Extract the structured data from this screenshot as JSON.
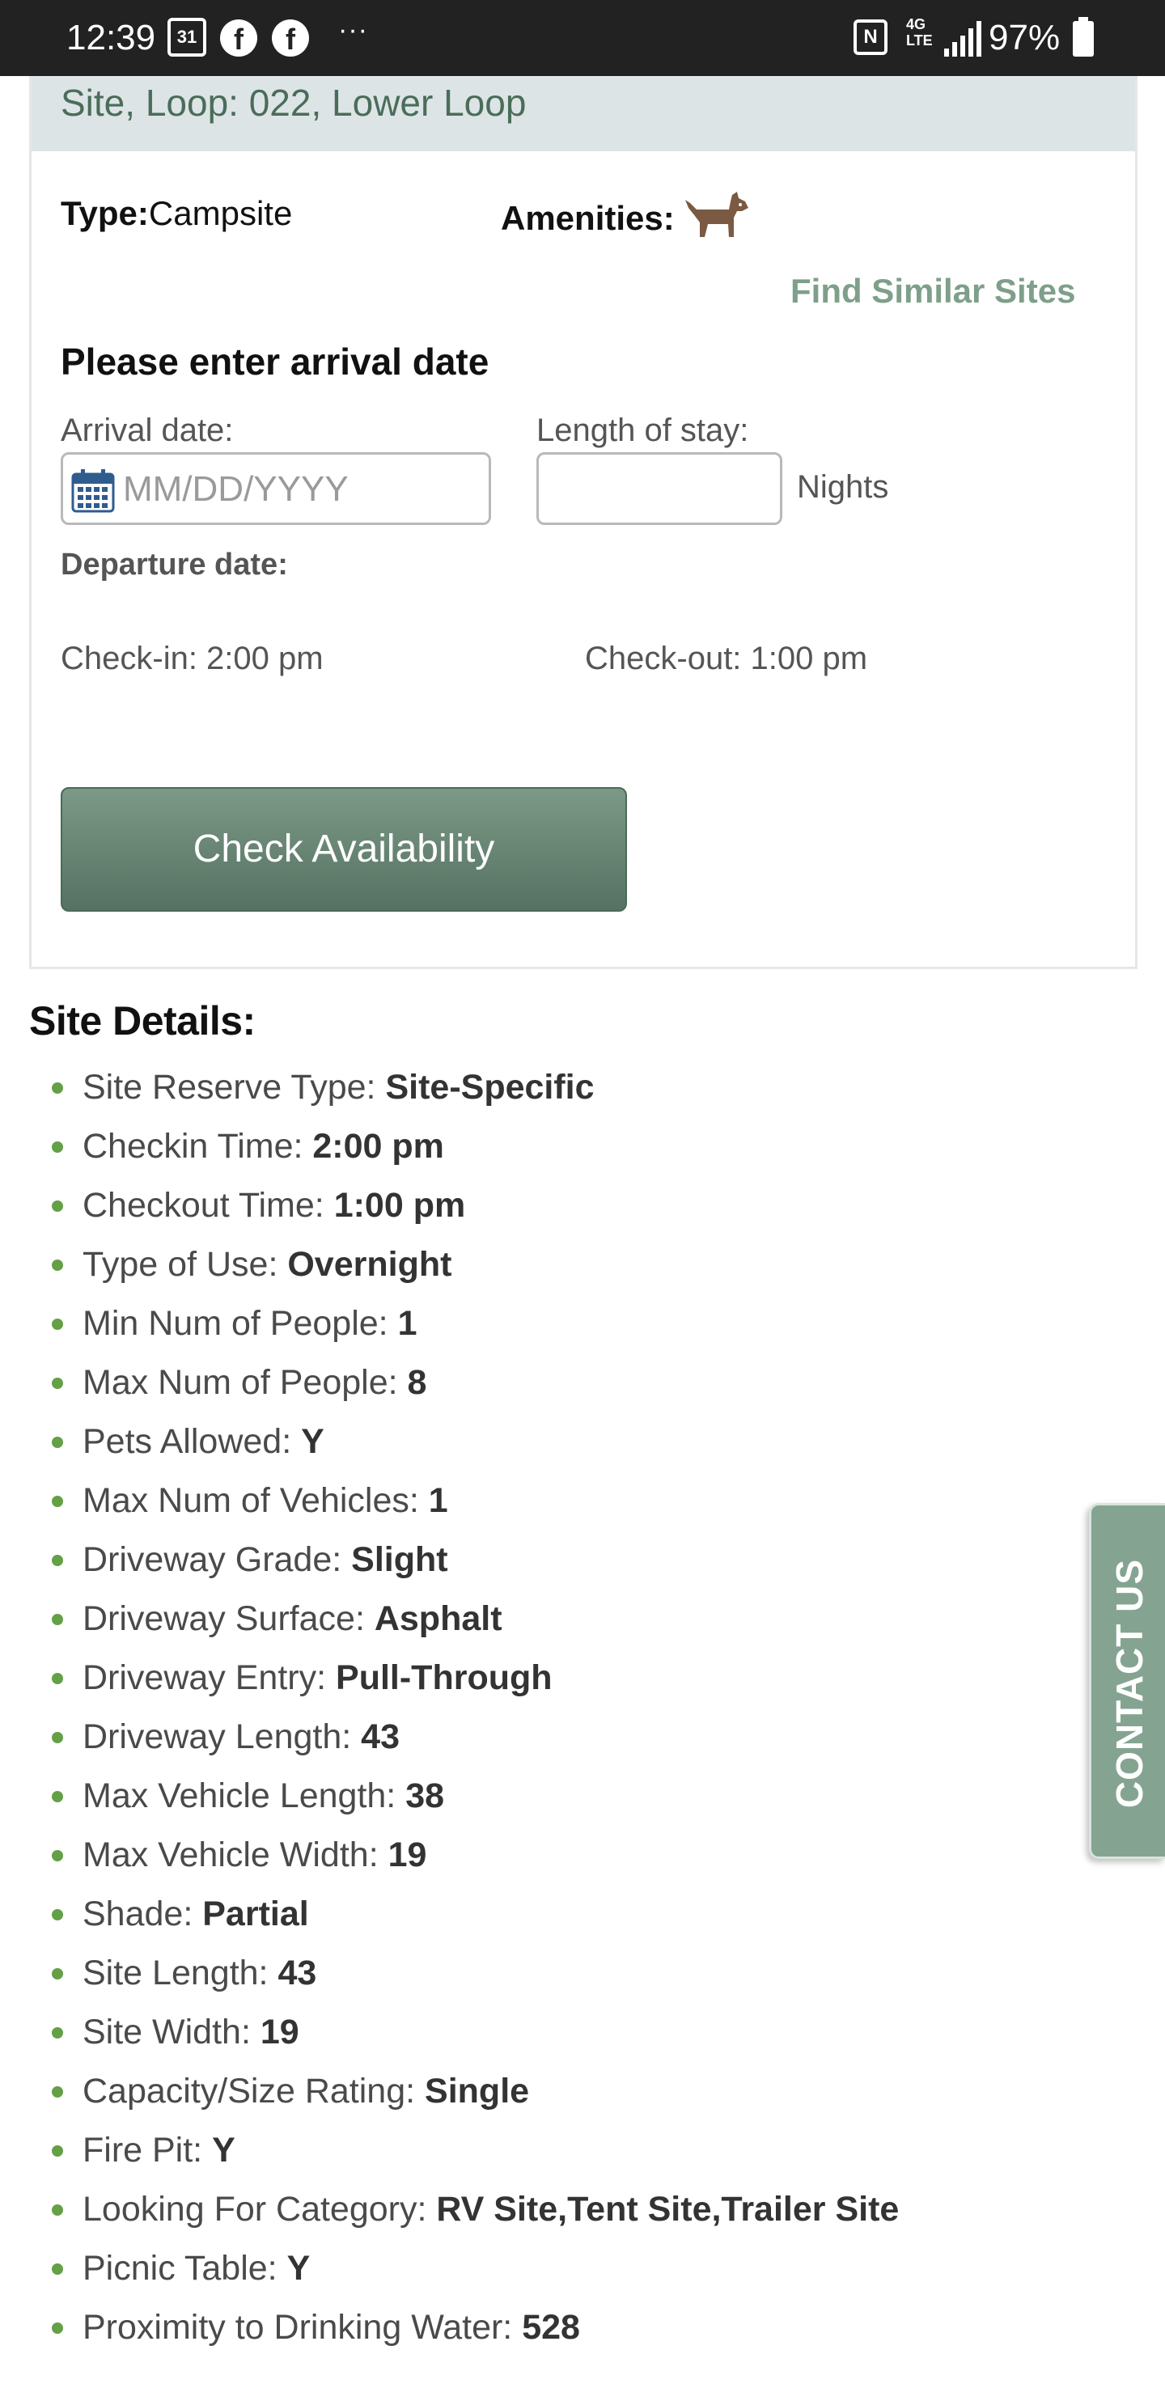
{
  "status_bar": {
    "time": "12:39",
    "calendar_day": "31",
    "dots": "···",
    "nfc": "N",
    "network": "4G LTE",
    "battery": "97%"
  },
  "site": {
    "header": "Site, Loop: 022, Lower Loop",
    "type_label": "Type:",
    "type_value": "Campsite",
    "amenities_label": "Amenities:",
    "amenity_icon": "dog-icon",
    "find_similar": "Find Similar Sites"
  },
  "booking": {
    "heading": "Please enter arrival date",
    "arrival_label": "Arrival date:",
    "arrival_placeholder": "MM/DD/YYYY",
    "stay_label": "Length of stay:",
    "stay_value": "",
    "nights": "Nights",
    "departure_label": "Departure date:",
    "checkin": "Check-in: 2:00 pm",
    "checkout": "Check-out: 1:00 pm",
    "button": "Check Availability"
  },
  "details": {
    "title": "Site Details:",
    "items": [
      {
        "label": "Site Reserve Type: ",
        "value": "Site-Specific"
      },
      {
        "label": "Checkin Time: ",
        "value": "2:00 pm"
      },
      {
        "label": "Checkout Time: ",
        "value": "1:00 pm"
      },
      {
        "label": "Type of Use: ",
        "value": "Overnight"
      },
      {
        "label": "Min Num of People: ",
        "value": "1"
      },
      {
        "label": "Max Num of People: ",
        "value": "8"
      },
      {
        "label": "Pets Allowed: ",
        "value": "Y"
      },
      {
        "label": "Max Num of Vehicles: ",
        "value": "1"
      },
      {
        "label": "Driveway Grade: ",
        "value": "Slight"
      },
      {
        "label": "Driveway Surface: ",
        "value": "Asphalt"
      },
      {
        "label": "Driveway Entry: ",
        "value": "Pull-Through"
      },
      {
        "label": "Driveway Length: ",
        "value": "43"
      },
      {
        "label": "Max Vehicle Length: ",
        "value": "38"
      },
      {
        "label": "Max Vehicle Width: ",
        "value": "19"
      },
      {
        "label": "Shade: ",
        "value": "Partial"
      },
      {
        "label": "Site Length: ",
        "value": "43"
      },
      {
        "label": "Site Width: ",
        "value": "19"
      },
      {
        "label": "Capacity/Size Rating: ",
        "value": "Single"
      },
      {
        "label": "Fire Pit: ",
        "value": "Y"
      },
      {
        "label": "Looking For Category: ",
        "value": "RV Site,Tent Site,Trailer Site"
      },
      {
        "label": "Picnic Table: ",
        "value": "Y"
      },
      {
        "label": "Proximity to Drinking Water: ",
        "value": "528"
      }
    ]
  },
  "contact_tab": "CONTACT US",
  "colors": {
    "accent_green": "#7e9f89",
    "header_bg": "#dde4e6",
    "button_bg": "#557262",
    "bullet": "#63a046"
  }
}
